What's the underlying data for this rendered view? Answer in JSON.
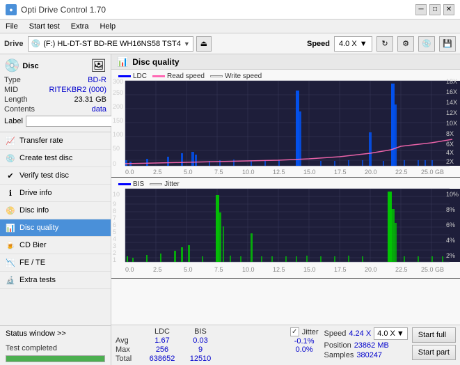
{
  "app": {
    "title": "Opti Drive Control 1.70",
    "icon": "●"
  },
  "titlebar": {
    "minimize": "─",
    "maximize": "□",
    "close": "✕"
  },
  "menubar": {
    "items": [
      "File",
      "Start test",
      "Extra",
      "Help"
    ]
  },
  "drivebar": {
    "label": "Drive",
    "drive_text": "(F:)  HL-DT-ST BD-RE  WH16NS58 TST4",
    "speed_label": "Speed",
    "speed_value": "4.0 X"
  },
  "disc": {
    "title": "Disc",
    "type_label": "Type",
    "type_value": "BD-R",
    "mid_label": "MID",
    "mid_value": "RITEKBR2 (000)",
    "length_label": "Length",
    "length_value": "23.31 GB",
    "contents_label": "Contents",
    "contents_value": "data",
    "label_label": "Label"
  },
  "nav": {
    "items": [
      {
        "id": "transfer-rate",
        "label": "Transfer rate",
        "icon": "📈"
      },
      {
        "id": "create-test-disc",
        "label": "Create test disc",
        "icon": "💿"
      },
      {
        "id": "verify-test-disc",
        "label": "Verify test disc",
        "icon": "✔"
      },
      {
        "id": "drive-info",
        "label": "Drive info",
        "icon": "ℹ"
      },
      {
        "id": "disc-info",
        "label": "Disc info",
        "icon": "📀"
      },
      {
        "id": "disc-quality",
        "label": "Disc quality",
        "icon": "📊",
        "active": true
      },
      {
        "id": "cd-bier",
        "label": "CD Bier",
        "icon": "🍺"
      },
      {
        "id": "fe-te",
        "label": "FE / TE",
        "icon": "📉"
      },
      {
        "id": "extra-tests",
        "label": "Extra tests",
        "icon": "🔬"
      }
    ]
  },
  "status": {
    "window_label": "Status window >>",
    "completed_label": "Test completed",
    "progress": 100
  },
  "quality_panel": {
    "title": "Disc quality"
  },
  "chart1": {
    "legend": [
      {
        "label": "LDC",
        "color": "#0000ff"
      },
      {
        "label": "Read speed",
        "color": "#ff69b4"
      },
      {
        "label": "Write speed",
        "color": "#ffffff"
      }
    ],
    "y_left": [
      "300",
      "",
      "200",
      "",
      "100",
      "",
      ""
    ],
    "y_right": [
      "18X",
      "16X",
      "14X",
      "12X",
      "10X",
      "8X",
      "6X",
      "4X",
      "2X"
    ],
    "x_labels": [
      "0.0",
      "2.5",
      "5.0",
      "7.5",
      "10.0",
      "12.5",
      "15.0",
      "17.5",
      "20.0",
      "22.5",
      "25.0 GB"
    ]
  },
  "chart2": {
    "legend": [
      {
        "label": "BIS",
        "color": "#0000ff"
      },
      {
        "label": "Jitter",
        "color": "#ffffff"
      }
    ],
    "y_left": [
      "10",
      "9",
      "8",
      "7",
      "6",
      "5",
      "4",
      "3",
      "2",
      "1"
    ],
    "y_right": [
      "10%",
      "8%",
      "6%",
      "4%",
      "2%"
    ],
    "x_labels": [
      "0.0",
      "2.5",
      "5.0",
      "7.5",
      "10.0",
      "12.5",
      "15.0",
      "17.5",
      "20.0",
      "22.5",
      "25.0 GB"
    ]
  },
  "stats": {
    "columns": [
      "LDC",
      "BIS"
    ],
    "jitter_label": "Jitter",
    "jitter_checked": true,
    "rows": [
      {
        "label": "Avg",
        "ldc": "1.67",
        "bis": "0.03",
        "jitter": "-0.1%"
      },
      {
        "label": "Max",
        "ldc": "256",
        "bis": "9",
        "jitter": "0.0%"
      },
      {
        "label": "Total",
        "ldc": "638652",
        "bis": "12510",
        "jitter": ""
      }
    ],
    "speed_label": "Speed",
    "speed_value": "4.24 X",
    "speed_dropdown": "4.0 X",
    "position_label": "Position",
    "position_value": "23862 MB",
    "samples_label": "Samples",
    "samples_value": "380247",
    "btn_full": "Start full",
    "btn_part": "Start part"
  }
}
